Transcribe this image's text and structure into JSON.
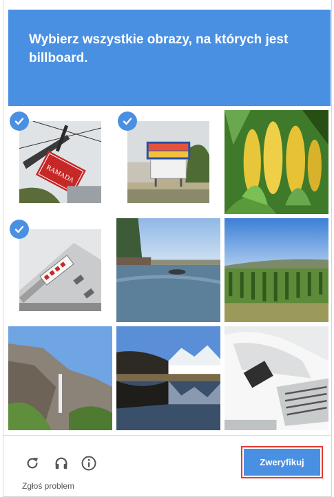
{
  "challenge": {
    "instruction": "Wybierz wszystkie obrazy, na których jest",
    "target": "billboard."
  },
  "tiles": [
    {
      "selected": true,
      "subject": "Ramada hotel sign on a pole"
    },
    {
      "selected": true,
      "subject": "roadside billboard"
    },
    {
      "selected": false,
      "subject": "corn cobs"
    },
    {
      "selected": true,
      "subject": "tilted building with signs"
    },
    {
      "selected": false,
      "subject": "river landscape"
    },
    {
      "selected": false,
      "subject": "vineyard field"
    },
    {
      "selected": false,
      "subject": "rocky cliff with waterfall"
    },
    {
      "selected": false,
      "subject": "lake with mountains reflection"
    },
    {
      "selected": false,
      "subject": "white truck front"
    }
  ],
  "footer": {
    "report_label": "Zgłoś problem",
    "verify_label": "Zweryfikuj",
    "icons": [
      "reload-icon",
      "audio-icon",
      "info-icon"
    ]
  },
  "colors": {
    "accent": "#4a90e2",
    "highlight_border": "#e53935"
  }
}
